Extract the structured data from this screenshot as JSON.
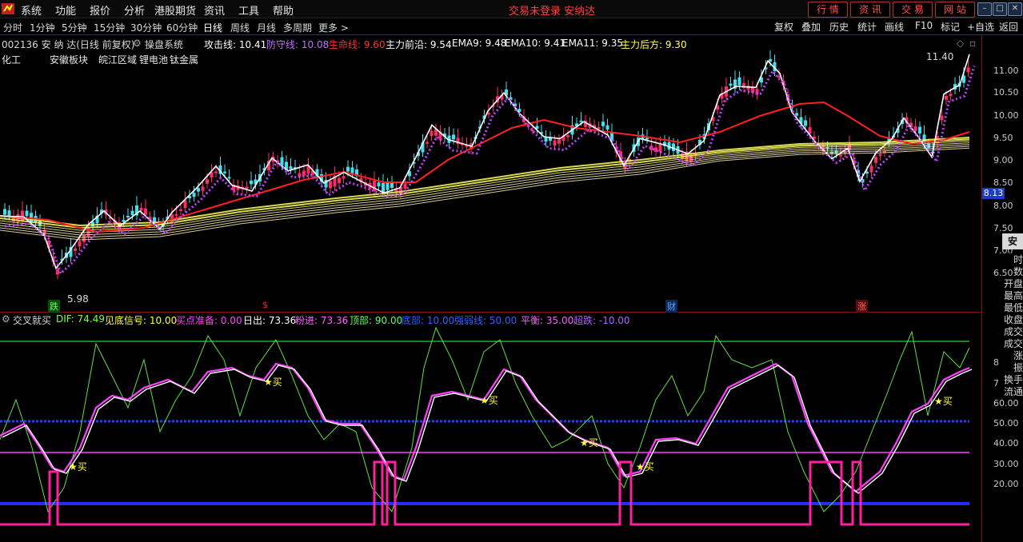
{
  "menu": [
    "系统",
    "功能",
    "报价",
    "分析",
    "港股期货",
    "资讯",
    "工具",
    "帮助"
  ],
  "window_title": "交易未登录 安纳达",
  "top_buttons": [
    "行 情",
    "资 讯",
    "交 易",
    "网 站"
  ],
  "periods": [
    "分时",
    "1分钟",
    "5分钟",
    "15分钟",
    "30分钟",
    "60分钟",
    "日线",
    "周线",
    "月线",
    "多周期",
    "更多 >"
  ],
  "right_tools": [
    "复权",
    "叠加",
    "历史",
    "统计",
    "画线",
    "F10",
    "标记",
    "+自选",
    "返回"
  ],
  "stock": {
    "label": "002136 安 纳 达(日线 前复权)",
    "system": "操盘系统"
  },
  "main_indicators": [
    {
      "label": "攻击线: 10.41",
      "color": "#ffffff"
    },
    {
      "label": "防守线: 10.08",
      "color": "#c070ff"
    },
    {
      "label": "生命线: 9.60",
      "color": "#ff3030"
    },
    {
      "label": "主力前沿: 9.54",
      "color": "#ffffff"
    },
    {
      "label": "EMA9: 9.48",
      "color": "#ffffff"
    },
    {
      "label": "EMA10: 9.41",
      "color": "#ffffff"
    },
    {
      "label": "EMA11: 9.35",
      "color": "#ffffff"
    },
    {
      "label": "主力后方: 9.30",
      "color": "#ffff60"
    }
  ],
  "sectors": [
    "化工",
    "安徽板块",
    "皖江区域",
    "锂电池",
    "钛金属"
  ],
  "price_axis": [
    "11.00",
    "10.50",
    "10.00",
    "9.50",
    "9.00",
    "8.50",
    "8.00",
    "7.50",
    "7.00",
    "6.50"
  ],
  "current_price": "8.13",
  "price_high": "11.40",
  "price_low": "5.98",
  "events": [
    {
      "label": "跌",
      "color": "#10a010"
    },
    {
      "label": "$",
      "color": "#ff2020"
    },
    {
      "label": "财",
      "color": "#3080ff"
    },
    {
      "label": "涨",
      "color": "#ff3030"
    }
  ],
  "side_panel": {
    "header": "安 纳",
    "items": [
      "时",
      "数",
      "开盘",
      "最高",
      "最低",
      "收盘",
      "成交",
      "成交",
      "涨",
      "振",
      "换手",
      "流通"
    ]
  },
  "lower": {
    "name": "交叉就买",
    "indicators": [
      {
        "label": "DIF: 74.49",
        "color": "#80ff40"
      },
      {
        "label": "见底信号: 10.00",
        "color": "#ffff40"
      },
      {
        "label": "买点准备: 0.00",
        "color": "#ff40ff"
      },
      {
        "label": "日出: 73.36",
        "color": "#ffffff"
      },
      {
        "label": "粉进: 73.36",
        "color": "#ff60ff"
      },
      {
        "label": "顶部: 90.00",
        "color": "#60ff60"
      },
      {
        "label": "底部: 10.00",
        "color": "#3060ff"
      },
      {
        "label": "强弱线: 50.00",
        "color": "#3060ff"
      },
      {
        "label": "平衡: 35.00",
        "color": "#ff60ff"
      },
      {
        "label": "超跌: -10.00",
        "color": "#b060ff"
      }
    ],
    "axis": [
      "8",
      "7",
      "60.00",
      "50.00",
      "40.00",
      "30.00",
      "20.00"
    ],
    "buy_label": "买"
  }
}
